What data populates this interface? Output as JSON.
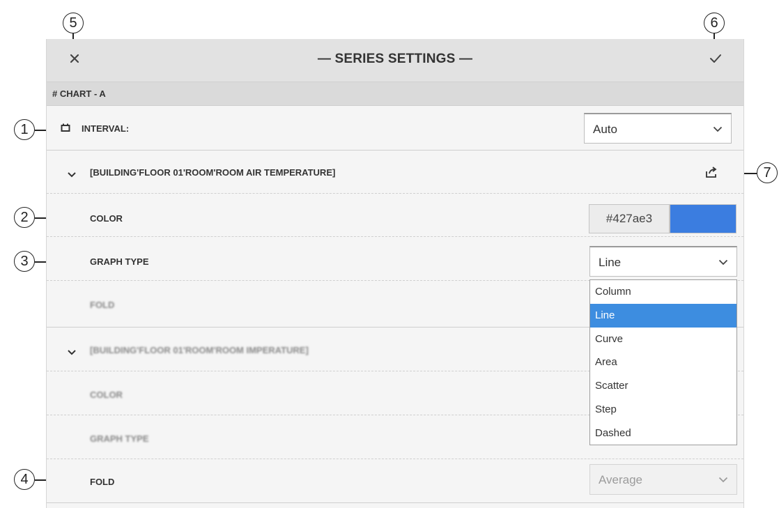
{
  "callouts": [
    "1",
    "2",
    "3",
    "4",
    "5",
    "6",
    "7"
  ],
  "header": {
    "title": "— SERIES SETTINGS —",
    "close_icon": "close-icon",
    "confirm_icon": "check-icon"
  },
  "chart_label": "# CHART - A",
  "interval": {
    "label": "INTERVAL:",
    "icon": "interval-icon",
    "value": "Auto"
  },
  "series": [
    {
      "name": "[BUILDING'FLOOR 01'ROOM'ROOM  AIR TEMPERATURE]",
      "expand_icon": "chevron-down-icon",
      "export_icon": "share-export-icon",
      "color_label": "COLOR",
      "color_hex": "#427ae3",
      "color_swatch": "#3b7de0",
      "graph_type_label": "GRAPH TYPE",
      "graph_type": "Line",
      "graph_type_options": [
        "Column",
        "Line",
        "Curve",
        "Area",
        "Scatter",
        "Step",
        "Dashed"
      ],
      "fold_label": "FOLD"
    },
    {
      "name": "[BUILDING'FLOOR 01'ROOM'ROOM IMPERATURE]",
      "color_label": "COLOR",
      "graph_type_label": "GRAPH TYPE",
      "fold_label": "FOLD",
      "fold_value": "Average"
    }
  ]
}
